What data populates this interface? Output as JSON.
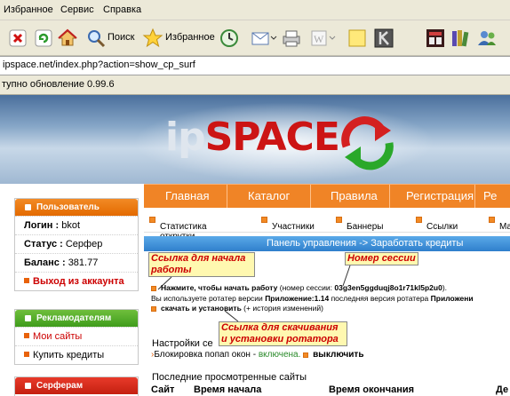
{
  "menubar": {
    "items": [
      "Избранное",
      "Сервис",
      "Справка"
    ]
  },
  "toolbar": {
    "search_label": "Поиск",
    "favorites_label": "Избранное"
  },
  "address": {
    "url": "ipspace.net/index.php?action=show_cp_surf"
  },
  "infobar": {
    "text": "тупно обновление 0.99.6"
  },
  "logo": {
    "ip": "ip",
    "space": "SPACE"
  },
  "nav": {
    "items": [
      "Главная",
      "Каталог",
      "Правила",
      "Регистрация",
      "Ре"
    ]
  },
  "subnav": {
    "items": [
      "Статистика открутки",
      "Участники",
      "Баннеры",
      "Ссылки",
      "Ma"
    ]
  },
  "sidebar": {
    "user": {
      "title": "Пользователь",
      "login_label": "Логин :",
      "login_value": "bkot",
      "status_label": "Статус :",
      "status_value": "Серфер",
      "balance_label": "Баланс :",
      "balance_value": "381.77",
      "logout": "Выход из аккаунта"
    },
    "advertisers": {
      "title": "Рекламодателям",
      "my_sites": "Мои сайты",
      "buy_credits": "Купить кредиты"
    },
    "surfers": {
      "title": "Серферам"
    }
  },
  "panel": {
    "title": "Панель управления -> Заработать кредиты"
  },
  "annotations": {
    "start_link": "Ссылка для начала работы",
    "session_number": "Номер сессии",
    "download_link": "Ссылка для скачивания и установки ротатора"
  },
  "content": {
    "start_text": "Нажмите, чтобы начать работу",
    "session_prefix": "(номер сессии:",
    "session_id": "03g3en5ggduqj8o1r71kl5p2u0",
    "session_suffix": ").",
    "version_line_1": "Вы используете ротатер версии",
    "version_app": "Приложение:1.14",
    "version_line_2": "последняя версия ротатера",
    "version_app2": "Приложени",
    "download_text": "скачать и установить",
    "history_text": "(+ история изменений)",
    "settings_title": "Настройки се",
    "popup_block_label": "Блокировка попап окон -",
    "popup_block_state": "включена.",
    "popup_block_toggle": "выключить",
    "recent_sites_title": "Последние просмотренные сайты",
    "col_site": "Сайт",
    "col_start": "Время начала",
    "col_end": "Время окончания",
    "col_extra": "Де"
  }
}
